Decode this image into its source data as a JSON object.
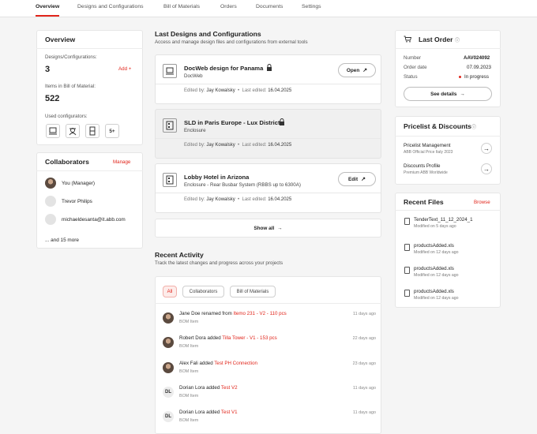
{
  "nav": {
    "tabs": [
      "Overview",
      "Designs and Configurations",
      "Bill of Materials",
      "Orders",
      "Documents",
      "Settings"
    ]
  },
  "overview": {
    "title": "Overview",
    "designs_label": "Designs/Configurations:",
    "designs_count": "3",
    "add_label": "Add +",
    "bom_label": "Items in Bill of Material:",
    "bom_count": "522",
    "configurators_label": "Used configurators:",
    "more_configurators": "5+"
  },
  "collaborators": {
    "title": "Collaborators",
    "manage_label": "Manage",
    "people": [
      "You (Manager)",
      "Trevor Philips",
      "michaeldesanta@it.abb.com"
    ],
    "more": "... and 15 more"
  },
  "designs": {
    "title": "Last Designs and Configurations",
    "subtitle": "Access and manage design files and configurations from external tools",
    "edited_by_label": "Edited by:",
    "last_edited_label": "Last edited:",
    "items": [
      {
        "title": "DocWeb design for Panama",
        "tool": "DocWeb",
        "editor": "Jay Kowalsky",
        "date": "16.04.2025",
        "action": "Open"
      },
      {
        "title": "SLD in Paris Europe - Lux District",
        "tool": "Enclosure",
        "editor": "Jay Kowalsky",
        "date": "16.04.2025",
        "action": ""
      },
      {
        "title": "Lobby Hotel in Arizona",
        "tool": "Enclosure - Rear Busbar System (RBBS up to 6300A)",
        "editor": "Jay Kowalsky",
        "date": "16.04.2025",
        "action": "Edit"
      }
    ],
    "show_all": "Show all"
  },
  "activity": {
    "title": "Recent Activity",
    "subtitle": "Track the latest changes and progress across your projects",
    "filters": [
      "All",
      "Collaborators",
      "Bill of Materials"
    ],
    "items": [
      {
        "initials": "",
        "who": "Jane Doe",
        "verb": "renamed from",
        "target": "Itemo 231 - V2 - 110 pcs",
        "kind": "BOM Item",
        "ago": "11 days ago"
      },
      {
        "initials": "",
        "who": "Robert Dora",
        "verb": "added",
        "target": "Tilla Tower - V1 - 153 pcs",
        "kind": "BOM Item",
        "ago": "22 days ago"
      },
      {
        "initials": "",
        "who": "Alex Fali",
        "verb": "added",
        "target": "Test PH Connection",
        "kind": "BOM Item",
        "ago": "23 days ago"
      },
      {
        "initials": "DL",
        "who": "Dorian Lora",
        "verb": "added",
        "target": "Test V2",
        "kind": "BOM Item",
        "ago": "11 days ago"
      },
      {
        "initials": "DL",
        "who": "Dorian Lora",
        "verb": "added",
        "target": "Test V1",
        "kind": "BOM Item",
        "ago": "11 days ago"
      }
    ]
  },
  "last_order": {
    "title": "Last Order",
    "number_label": "Number",
    "number": "AAV024092",
    "date_label": "Order date",
    "date": "07.09.2023",
    "status_label": "Status",
    "status": "In progress",
    "details": "See details"
  },
  "pricelist": {
    "title": "Pricelist & Discounts",
    "items": [
      {
        "title": "Pricelist Management",
        "sub": "ABB Official Price Italy 2023"
      },
      {
        "title": "Discounts Profile",
        "sub": "Premium ABB Worldwide"
      }
    ]
  },
  "files": {
    "title": "Recent Files",
    "browse": "Browse",
    "items": [
      {
        "name": "TenderText_11_12_2024_1",
        "modified": "Modified on 5 days ago"
      },
      {
        "name": "productsAdded.xls",
        "modified": "Modified on 12 days ago"
      },
      {
        "name": "productsAdded.xls",
        "modified": "Modified on 12 days ago"
      },
      {
        "name": "productsAdded.xls",
        "modified": "Modified on 12 days ago"
      }
    ]
  },
  "colors": {
    "accent": "#e1251b",
    "background": "#f5f5f5"
  }
}
